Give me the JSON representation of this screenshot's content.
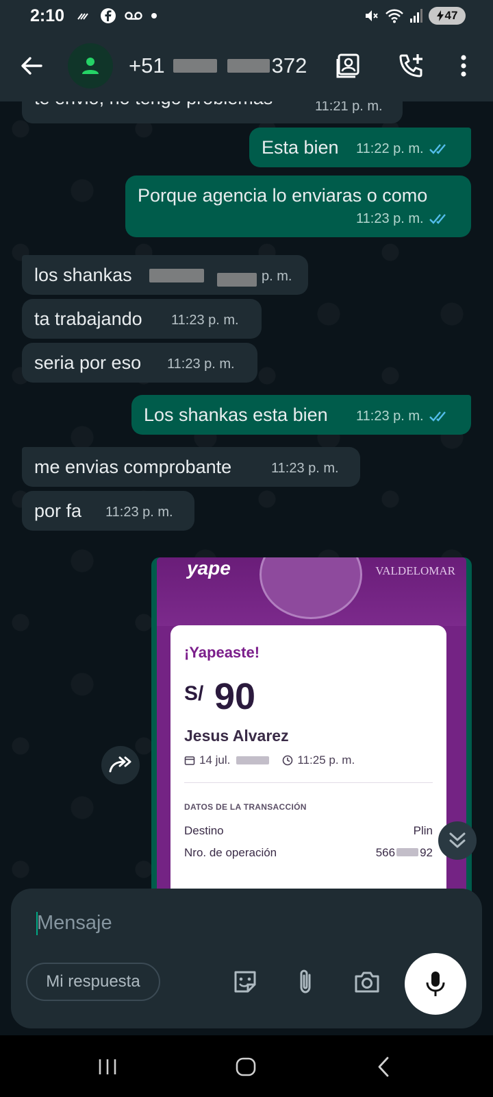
{
  "status_bar": {
    "time": "2:10",
    "battery": "47",
    "icons": [
      "missed-call-icon",
      "facebook-icon",
      "voicemail-icon",
      "dot-icon",
      "mute-icon",
      "wifi-icon",
      "signal-icon",
      "battery-icon"
    ]
  },
  "header": {
    "contact_prefix": "+51",
    "contact_suffix": "372",
    "icons": [
      "back-icon",
      "contact-avatar-icon",
      "contact-card-icon",
      "add-call-icon",
      "more-icon"
    ]
  },
  "messages": [
    {
      "id": "m1",
      "dir": "in",
      "text": "te envio, no tengo problemas",
      "time": "11:21 p. m."
    },
    {
      "id": "m2",
      "dir": "out",
      "text": "Esta bien",
      "time": "11:22 p. m.",
      "status": "read"
    },
    {
      "id": "m3",
      "dir": "out",
      "text": "Porque agencia lo enviaras o como",
      "time": "11:23 p. m.",
      "status": "read"
    },
    {
      "id": "m4",
      "dir": "in",
      "text": "los shankas",
      "time": "p. m."
    },
    {
      "id": "m5",
      "dir": "in",
      "text": "ta trabajando",
      "time": "11:23 p. m."
    },
    {
      "id": "m6",
      "dir": "in",
      "text": "seria por eso",
      "time": "11:23 p. m."
    },
    {
      "id": "m7",
      "dir": "out",
      "text": "Los shankas esta bien",
      "time": "11:23 p. m.",
      "status": "read"
    },
    {
      "id": "m8",
      "dir": "in",
      "text": "me envias comprobante",
      "time": "11:23 p. m."
    },
    {
      "id": "m9",
      "dir": "in",
      "text": "por fa",
      "time": "11:23 p. m."
    }
  ],
  "receipt": {
    "logo": "yape",
    "banner_text": "VALDELOMAR",
    "title": "¡Yapeaste!",
    "currency": "S/",
    "amount": "90",
    "name": "Jesus Alvarez",
    "date": "14 jul.",
    "time": "11:25 p. m.",
    "section": "DATOS DE LA TRANSACCIÓN",
    "destino_label": "Destino",
    "destino_value": "Plin",
    "operacion_label": "Nro. de operación",
    "operacion_prefix": "566",
    "operacion_suffix": "92"
  },
  "composer": {
    "placeholder": "Mensaje",
    "quick_reply": "Mi respuesta",
    "icons": [
      "sticker-icon",
      "attach-icon",
      "camera-icon",
      "mic-icon"
    ]
  },
  "colors": {
    "background": "#0b141a",
    "incoming": "#1f2c33",
    "outgoing": "#005c4b",
    "read_ticks": "#53bdeb",
    "accent": "#00a884",
    "yape_purple": "#742384"
  }
}
